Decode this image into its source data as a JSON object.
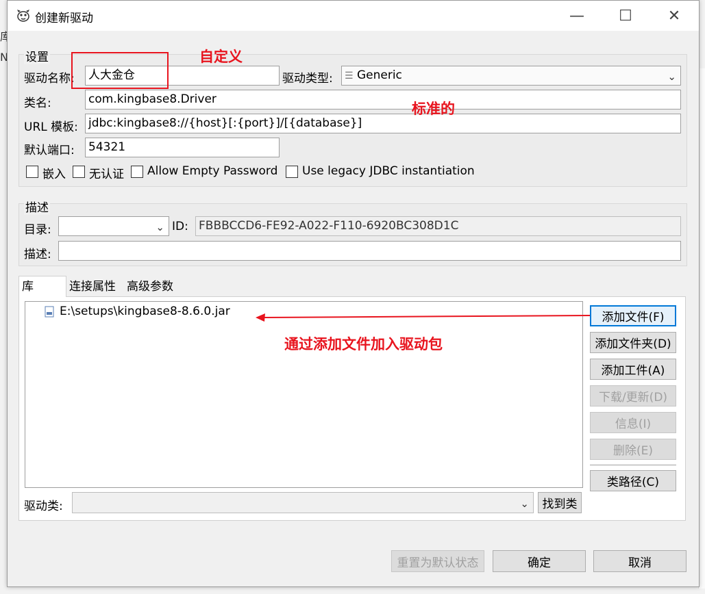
{
  "background_app": {
    "left_chars": [
      "库",
      "N"
    ]
  },
  "window": {
    "title": "创建新驱动",
    "controls": {
      "minimize": "—",
      "maximize": "☐",
      "close": "✕"
    }
  },
  "settings": {
    "legend": "设置",
    "driver_name_label": "驱动名称:",
    "driver_name_value": "人大金仓",
    "driver_type_label": "驱动类型:",
    "driver_type_value": "Generic",
    "class_label": "类名:",
    "class_value": "com.kingbase8.Driver",
    "url_label": "URL 模板:",
    "url_value": "jdbc:kingbase8://{host}[:{port}]/[{database}]",
    "port_label": "默认端口:",
    "port_value": "54321",
    "checkboxes": [
      {
        "label": "嵌入",
        "checked": false
      },
      {
        "label": "无认证",
        "checked": false
      },
      {
        "label": "Allow Empty Password",
        "checked": false
      },
      {
        "label": "Use legacy JDBC instantiation",
        "checked": false
      }
    ]
  },
  "description": {
    "legend": "描述",
    "category_label": "目录:",
    "category_value": "",
    "id_label": "ID:",
    "id_value": "FBBBCCD6-FE92-A022-F110-6920BC308D1C",
    "desc_label": "描述:",
    "desc_value": ""
  },
  "tabs": [
    {
      "label": "库",
      "active": true
    },
    {
      "label": "连接属性",
      "active": false
    },
    {
      "label": "高级参数",
      "active": false
    }
  ],
  "libraries": {
    "files": [
      {
        "name": "E:\\setups\\kingbase8-8.6.0.jar",
        "icon": "jar-file-icon"
      }
    ],
    "buttons": {
      "add_file": "添加文件(F)",
      "add_folder": "添加文件夹(D)",
      "add_artifact": "添加工件(A)",
      "download": "下载/更新(D)",
      "info": "信息(I)",
      "delete": "删除(E)",
      "classpath": "类路径(C)"
    },
    "driver_class_label": "驱动类:",
    "driver_class_value": "",
    "find_class": "找到类"
  },
  "footer": {
    "reset": "重置为默认状态",
    "ok": "确定",
    "cancel": "取消"
  },
  "annotations": {
    "custom": "自定义",
    "standard": "标准的",
    "add_file_hint": "通过添加文件加入驱动包"
  },
  "colors": {
    "annotation": "#e8141e",
    "focus_border": "#0078d7"
  }
}
